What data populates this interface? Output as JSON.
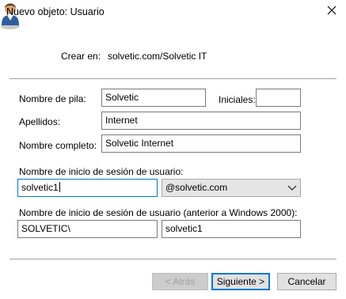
{
  "dialog": {
    "title": "Nuevo objeto: Usuario"
  },
  "header": {
    "create_in_label": "Crear en:",
    "create_in_value": "solvetic.com/Solvetic IT",
    "icon": "user-icon"
  },
  "form": {
    "first_name_label": "Nombre de pila:",
    "first_name_value": "Solvetic",
    "initials_label": "Iniciales:",
    "initials_value": "",
    "last_name_label": "Apellidos:",
    "last_name_value": "Internet",
    "full_name_label": "Nombre completo:",
    "full_name_value": "Solvetic Internet",
    "logon_name_label": "Nombre de inicio de sesión de usuario:",
    "logon_name_value": "solvetic1",
    "domain_value": "@solvetic.com",
    "pre2000_label": "Nombre de inicio de sesión de usuario (anterior a Windows 2000):",
    "pre2000_domain_value": "SOLVETIC\\",
    "pre2000_name_value": "solvetic1"
  },
  "buttons": {
    "back_label": "< Atrás",
    "next_label": "Siguiente >",
    "cancel_label": "Cancelar"
  },
  "colors": {
    "focus_border": "#0078d7",
    "button_face": "#e1e1e1"
  }
}
